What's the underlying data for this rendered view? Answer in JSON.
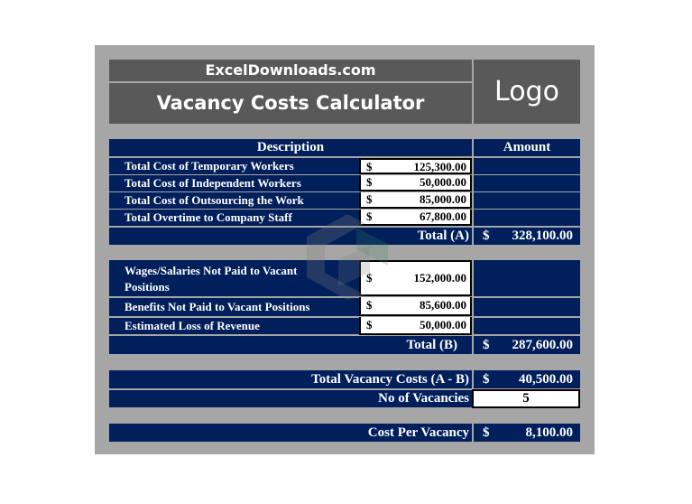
{
  "header": {
    "site": "ExcelDownloads.com",
    "title": "Vacancy Costs Calculator",
    "logo": "Logo"
  },
  "columns": {
    "description": "Description",
    "amount": "Amount"
  },
  "section_a": {
    "items": [
      {
        "label": "Total Cost of Temporary Workers",
        "currency": "$",
        "value": "125,300.00"
      },
      {
        "label": "Total Cost of Independent Workers",
        "currency": "$",
        "value": "50,000.00"
      },
      {
        "label": "Total Cost of Outsourcing the Work",
        "currency": "$",
        "value": "85,000.00"
      },
      {
        "label": "Total Overtime to Company Staff",
        "currency": "$",
        "value": "67,800.00"
      }
    ],
    "total_label": "Total (A)",
    "total_currency": "$",
    "total_value": "328,100.00"
  },
  "section_b": {
    "items": [
      {
        "label": "Wages/Salaries Not Paid to Vacant Positions",
        "currency": "$",
        "value": "152,000.00"
      },
      {
        "label": "Benefits Not Paid to Vacant Positions",
        "currency": "$",
        "value": "85,600.00"
      },
      {
        "label": "Estimated Loss of Revenue",
        "currency": "$",
        "value": "50,000.00"
      }
    ],
    "total_label": "Total (B)",
    "total_currency": "$",
    "total_value": "287,600.00"
  },
  "summary": {
    "total_vacancy_label": "Total Vacancy Costs (A - B)",
    "total_vacancy_currency": "$",
    "total_vacancy_value": "40,500.00",
    "vacancies_label": "No of Vacancies",
    "vacancies_value": "5",
    "cost_per_label": "Cost Per Vacancy",
    "cost_per_currency": "$",
    "cost_per_value": "8,100.00"
  },
  "colors": {
    "navy": "#001F5B",
    "header_gray": "#595959",
    "frame_gray": "#A6A6A6"
  }
}
